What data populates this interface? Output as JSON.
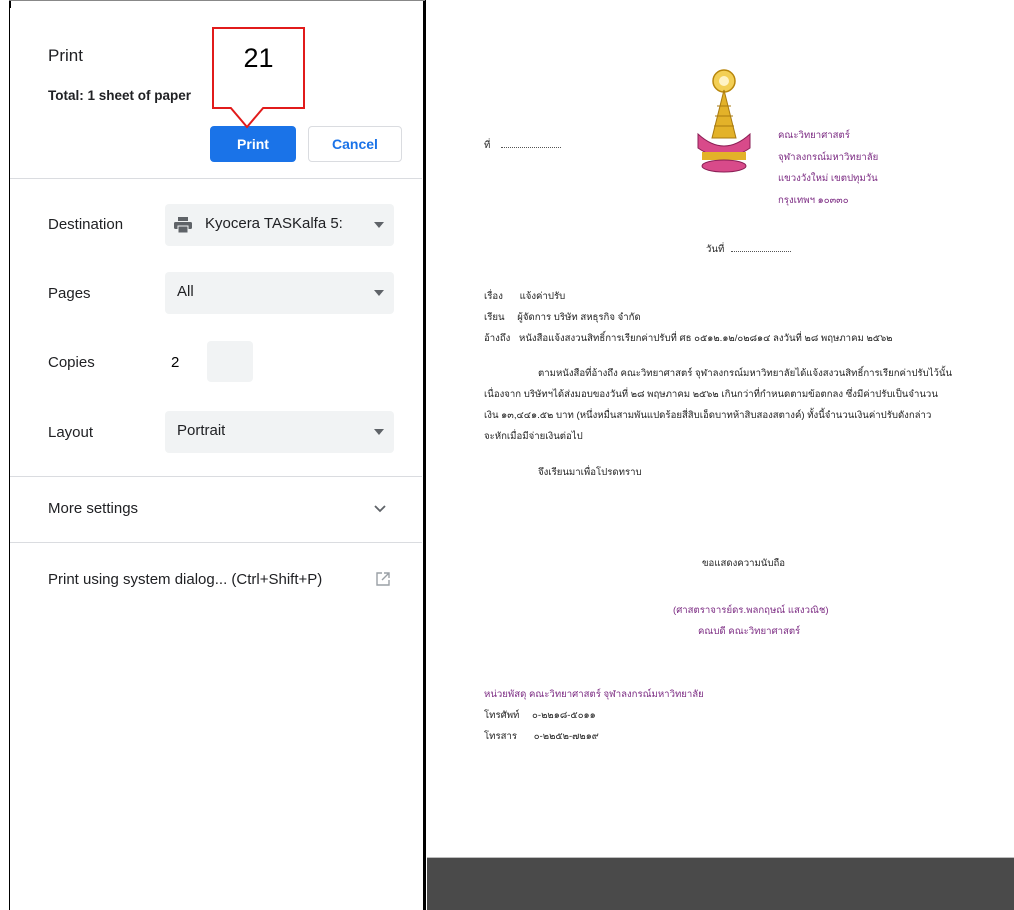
{
  "dialog": {
    "title": "Print",
    "total": "Total: 1 sheet of paper",
    "print_label": "Print",
    "cancel_label": "Cancel",
    "destination_label": "Destination",
    "destination_value": "Kyocera TASKalfa 5:",
    "destination_icon": "printer-icon",
    "pages_label": "Pages",
    "pages_value": "All",
    "copies_label": "Copies",
    "copies_value": "2",
    "layout_label": "Layout",
    "layout_value": "Portrait",
    "more_settings_label": "More settings",
    "system_dialog_label": "Print using system dialog... (Ctrl+Shift+P)",
    "system_dialog_icon": "open-in-new-icon"
  },
  "callout": {
    "text": "21",
    "border_color": "#e11b1b"
  },
  "colors": {
    "accent": "#1a73e8",
    "doc_purple": "#7b2a82",
    "emblem_gold": "#d9a21b",
    "emblem_pink": "#d84a8a"
  },
  "document": {
    "no_label": "ที่",
    "faculty": "คณะวิทยาศาสตร์",
    "university": "จุฬาลงกรณ์มหาวิทยาลัย",
    "district": "แขวงวังใหม่ เขตปทุมวัน",
    "city": "กรุงเทพฯ ๑๐๓๓๐",
    "date_label": "วันที่",
    "subject_label": "เรื่อง",
    "subject": "แจ้งค่าปรับ",
    "to_label": "เรียน",
    "to": "ผู้จัดการ บริษัท สหธุรกิจ จำกัด",
    "ref_label": "อ้างถึง",
    "ref": "หนังสือแจ้งสงวนสิทธิ์การเรียกค่าปรับที่ ศธ ๐๕๑๒.๑๒/๐๒๘๑๔ ลงวันที่ ๒๘ พฤษภาคม ๒๕๖๒",
    "body1": "ตามหนังสือที่อ้างถึง คณะวิทยาศาสตร์ จุฬาลงกรณ์มหาวิทยาลัยได้แจ้งสงวนสิทธิ์การเรียกค่าปรับไว้นั้น",
    "body2": "เนื่องจาก บริษัทฯได้ส่งมอบของวันที่ ๒๘ พฤษภาคม ๒๕๖๒ เกินกว่าที่กำหนดตามข้อตกลง ซึ่งมีค่าปรับเป็นจำนวน",
    "body3": "เงิน ๑๓,๔๔๑.๕๒ บาท (หนึ่งหมื่นสามพันแปดร้อยสี่สิบเอ็ดบาทห้าสิบสองสตางค์) ทั้งนี้จำนวนเงินค่าปรับดังกล่าว",
    "body4": "จะหักเมื่อมีจ่ายเงินต่อไป",
    "closing_request": "จึงเรียนมาเพื่อโปรดทราบ",
    "regards": "ขอแสดงความนับถือ",
    "signer": "(ศาสตราจารย์ดร.พลกฤษณ์ แสงวณิช)",
    "signer_title": "คณบดี คณะวิทยาศาสตร์",
    "unit": "หน่วยพัสดุ คณะวิทยาศาสตร์ จุฬาลงกรณ์มหาวิทยาลัย",
    "phone_label": "โทรศัพท์",
    "phone": "๐-๒๒๑๘-๕๐๑๑",
    "fax_label": "โทรสาร",
    "fax": "๐-๒๒๕๒-๗๒๑๙",
    "emblem": "university-emblem-icon"
  }
}
